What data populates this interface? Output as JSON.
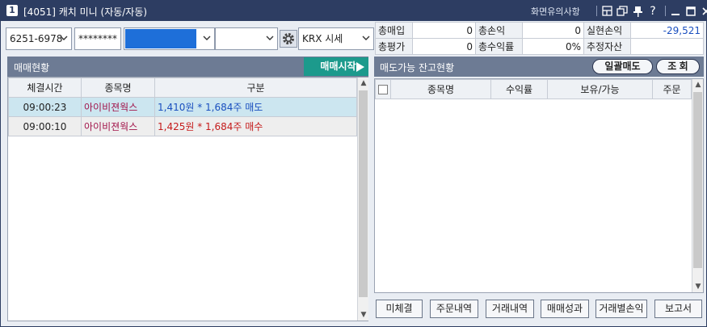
{
  "window": {
    "number_badge": "1",
    "title": "[4051] 캐치 미니 (자동/자동)",
    "notice_link": "화면유의사항",
    "title_icons": [
      "layout-icon",
      "restore-icon",
      "pin-icon",
      "help-icon",
      "minimize-icon",
      "maximize-icon",
      "close-icon"
    ]
  },
  "toolbar": {
    "account": "6251-6978",
    "password_mask": "********",
    "selector2": "",
    "selector3": "",
    "market": "KRX 시세"
  },
  "summary": {
    "rows": [
      [
        {
          "label": "총매입",
          "value": "0"
        },
        {
          "label": "총손익",
          "value": "0"
        },
        {
          "label": "실현손익",
          "value": "-29,521"
        }
      ],
      [
        {
          "label": "총평가",
          "value": "0"
        },
        {
          "label": "총수익률",
          "value": "0%"
        },
        {
          "label": "추정자산",
          "value": ""
        }
      ]
    ]
  },
  "trade_panel": {
    "title": "매매현황",
    "start_button": "매매시작",
    "headers": [
      "체결시간",
      "종목명",
      "구분"
    ],
    "rows": [
      {
        "time": "09:00:23",
        "name": "아이비젼웍스",
        "detail": "1,410원 * 1,684주 매도",
        "side": "sell"
      },
      {
        "time": "09:00:10",
        "name": "아이비젼웍스",
        "detail": "1,425원 * 1,684주 매수",
        "side": "buy"
      }
    ]
  },
  "balance_panel": {
    "title": "매도가능 잔고현황",
    "sell_all_button": "일괄매도",
    "query_button": "조 회",
    "headers": [
      "종목명",
      "수익률",
      "보유/가능",
      "주문"
    ]
  },
  "bottom_buttons": [
    "미체결",
    "주문내역",
    "거래내역",
    "매매성과",
    "거래별손익",
    "보고서"
  ],
  "colors": {
    "title_bar": "#2d3d62",
    "panel_header": "#6d7b94",
    "start_button": "#1c9a8c",
    "selected_field": "#1e6fd9",
    "sell_text": "#1a4fbf",
    "buy_text": "#c51b1b",
    "stock_name": "#a2144a"
  }
}
